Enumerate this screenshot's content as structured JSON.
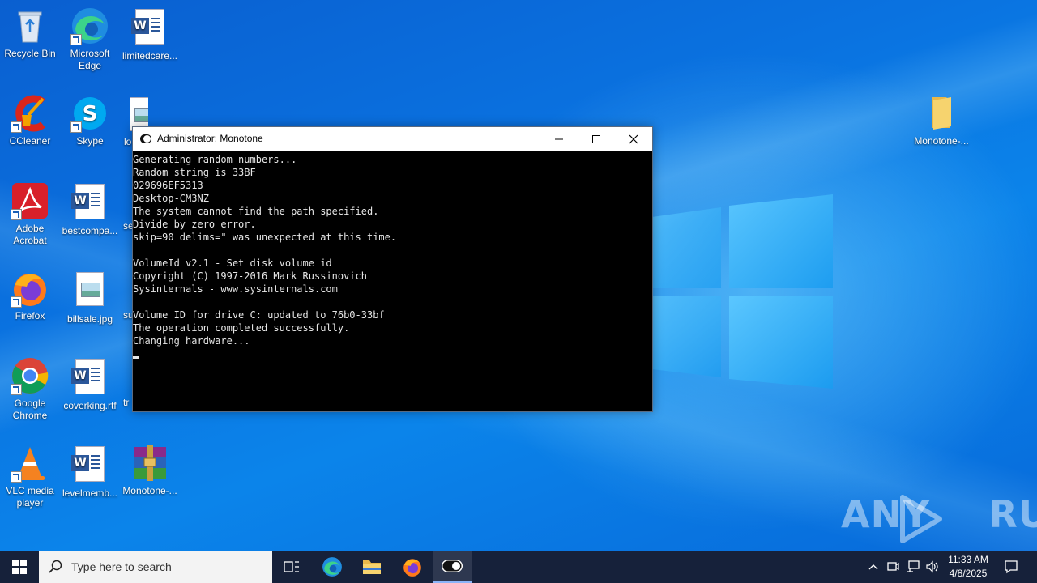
{
  "desktop": {
    "icons_left": [
      {
        "label": "Recycle Bin",
        "icon": "recycle-bin-icon"
      },
      {
        "label": "Microsoft Edge",
        "icon": "edge-icon"
      },
      {
        "label": "limitedcare...",
        "icon": "word-doc-icon"
      },
      {
        "label": "CCleaner",
        "icon": "ccleaner-icon"
      },
      {
        "label": "Skype",
        "icon": "skype-icon"
      },
      {
        "label": "lo",
        "icon": "image-file-icon"
      },
      {
        "label": "Adobe Acrobat",
        "icon": "acrobat-icon"
      },
      {
        "label": "bestcompa...",
        "icon": "word-doc-icon"
      },
      {
        "label": "se",
        "icon": "word-doc-icon"
      },
      {
        "label": "Firefox",
        "icon": "firefox-icon"
      },
      {
        "label": "billsale.jpg",
        "icon": "image-file-icon"
      },
      {
        "label": "su",
        "icon": "word-doc-icon"
      },
      {
        "label": "Google Chrome",
        "icon": "chrome-icon"
      },
      {
        "label": "coverking.rtf",
        "icon": "word-doc-icon"
      },
      {
        "label": "tr",
        "icon": "word-doc-icon"
      },
      {
        "label": "VLC media player",
        "icon": "vlc-icon"
      },
      {
        "label": "levelmemb...",
        "icon": "word-doc-icon"
      },
      {
        "label": "Monotone-...",
        "icon": "winrar-icon"
      }
    ],
    "icon_right": {
      "label": "Monotone-...",
      "icon": "folder-icon"
    }
  },
  "console": {
    "title": "Administrator:  Monotone",
    "lines": [
      "Generating random numbers...",
      "Random string is 33BF",
      "029696EF5313",
      "Desktop-CM3NZ",
      "The system cannot find the path specified.",
      "Divide by zero error.",
      "skip=90 delims=\" was unexpected at this time.",
      "",
      "VolumeId v2.1 - Set disk volume id",
      "Copyright (C) 1997-2016 Mark Russinovich",
      "Sysinternals - www.sysinternals.com",
      "",
      "Volume ID for drive C: updated to 76b0-33bf",
      "The operation completed successfully.",
      "Changing hardware..."
    ]
  },
  "watermark": {
    "left": "ANY",
    "right": "RUN"
  },
  "taskbar": {
    "search_placeholder": "Type here to search",
    "time": "11:33 AM",
    "date": "4/8/2025"
  },
  "colors": {
    "accent": "#0a72e0",
    "taskbar": "#16213a",
    "console_bg": "#000000"
  }
}
